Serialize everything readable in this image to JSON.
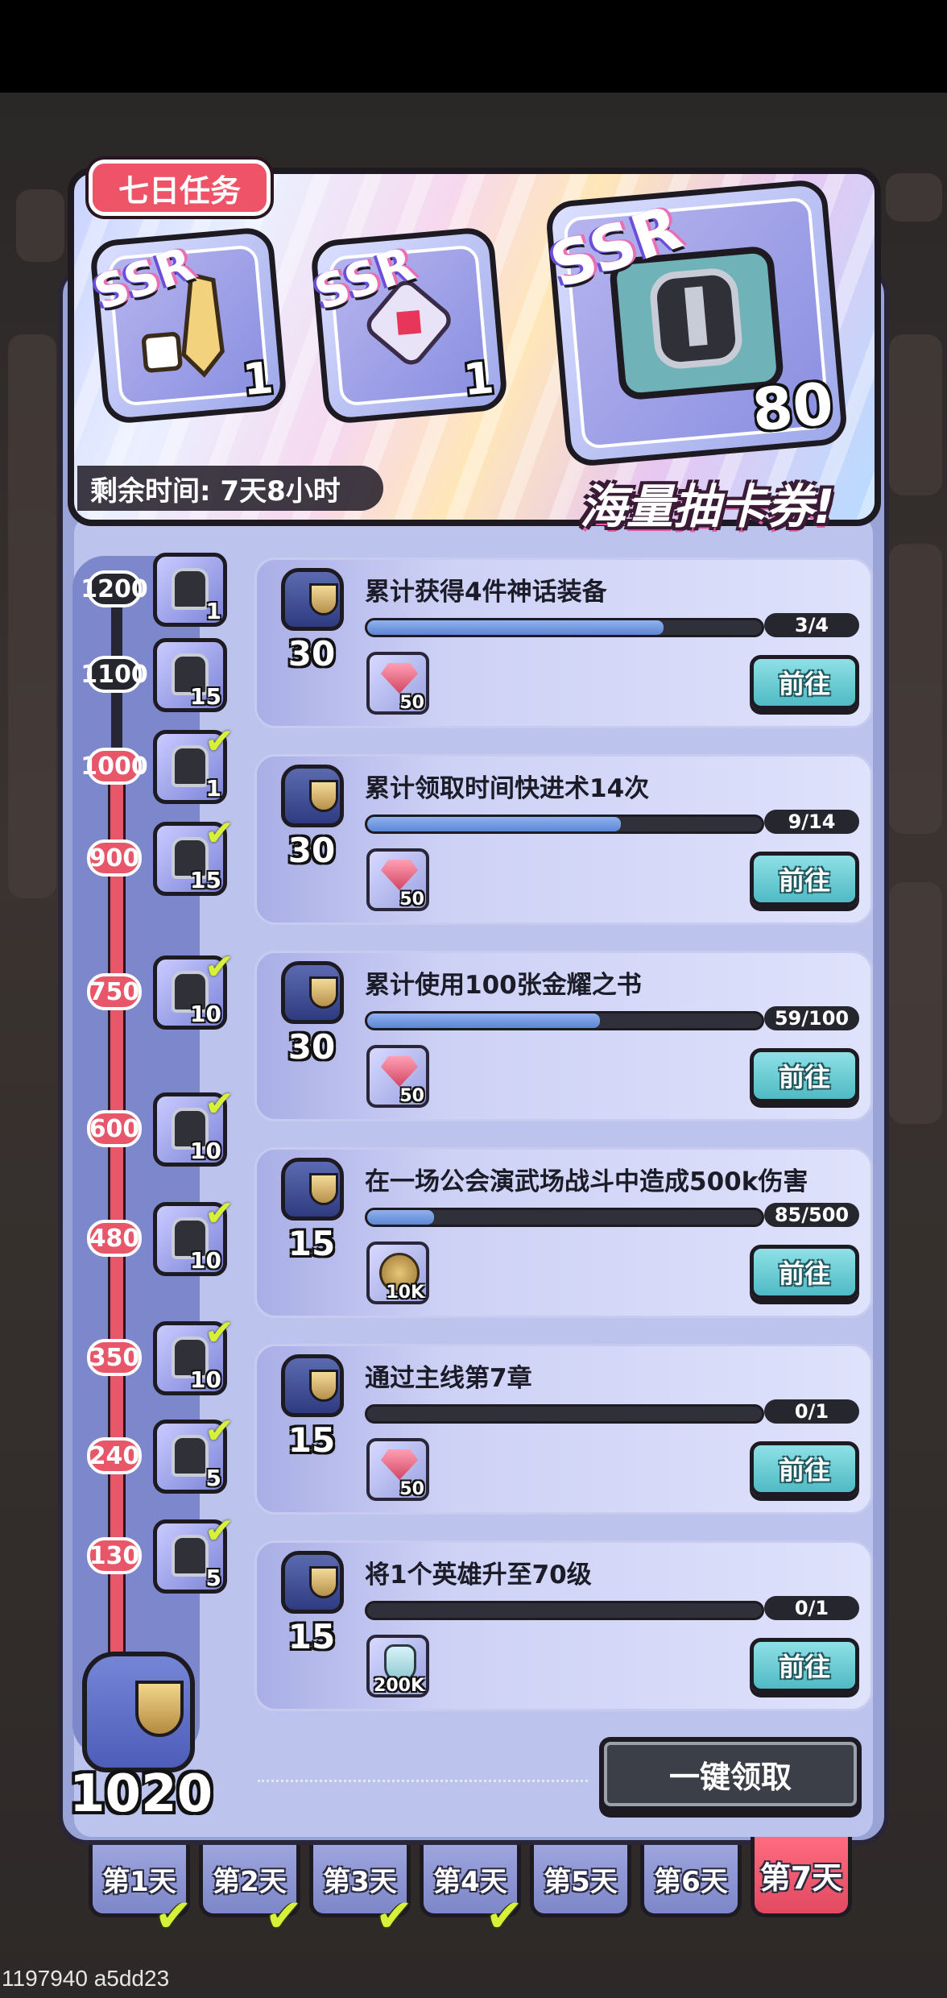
{
  "header": {
    "title": "七日任务",
    "timer": "剩余时间: 7天8小时",
    "slogan": "海量抽卡券!"
  },
  "banner_rewards": [
    {
      "tier": "SSR",
      "count": "1",
      "icon": "ssr-gold-relic-icon"
    },
    {
      "tier": "SSR",
      "count": "1",
      "icon": "ssr-red-gem-equipment-icon"
    },
    {
      "tier": "SSR",
      "count": "80",
      "icon": "ssr-summon-ticket-book-icon"
    }
  ],
  "milestones": [
    {
      "points": "1200",
      "count": "1",
      "claimed": false,
      "icon": "gem-equipment-icon"
    },
    {
      "points": "1100",
      "count": "15",
      "claimed": false,
      "icon": "helmet-book-icon"
    },
    {
      "points": "1000",
      "count": "1",
      "claimed": true,
      "icon": "ssr-relic-icon"
    },
    {
      "points": "900",
      "count": "15",
      "claimed": true,
      "icon": "helmet-book-icon"
    },
    {
      "points": "750",
      "count": "10",
      "claimed": true,
      "icon": "helmet-book-icon"
    },
    {
      "points": "600",
      "count": "10",
      "claimed": true,
      "icon": "helmet-book-icon"
    },
    {
      "points": "480",
      "count": "10",
      "claimed": true,
      "icon": "helmet-book-icon"
    },
    {
      "points": "350",
      "count": "10",
      "claimed": true,
      "icon": "helmet-book-icon"
    },
    {
      "points": "240",
      "count": "5",
      "claimed": true,
      "icon": "helmet-book-icon"
    },
    {
      "points": "130",
      "count": "5",
      "claimed": true,
      "icon": "helmet-book-icon"
    }
  ],
  "total_points": "1020",
  "tasks": [
    {
      "title": "累计获得4件神话装备",
      "points": "30",
      "progress_text": "3/4",
      "progress": 0.75,
      "reward_count": "50",
      "reward_icon": "gem"
    },
    {
      "title": "累计领取时间快进术14次",
      "points": "30",
      "progress_text": "9/14",
      "progress": 0.643,
      "reward_count": "50",
      "reward_icon": "gem"
    },
    {
      "title": "累计使用100张金耀之书",
      "points": "30",
      "progress_text": "59/100",
      "progress": 0.59,
      "reward_count": "50",
      "reward_icon": "gem"
    },
    {
      "title": "在一场公会演武场战斗中造成500k伤害",
      "points": "15",
      "progress_text": "85/500",
      "progress": 0.17,
      "reward_count": "10K",
      "reward_icon": "coin"
    },
    {
      "title": "通过主线第7章",
      "points": "15",
      "progress_text": "0/1",
      "progress": 0,
      "reward_count": "50",
      "reward_icon": "gem"
    },
    {
      "title": "将1个英雄升至70级",
      "points": "15",
      "progress_text": "0/1",
      "progress": 0,
      "reward_count": "200K",
      "reward_icon": "potion"
    }
  ],
  "go_label": "前往",
  "claim_all_label": "一键领取",
  "days": [
    {
      "label": "第1天",
      "completed": true,
      "active": false
    },
    {
      "label": "第2天",
      "completed": true,
      "active": false
    },
    {
      "label": "第3天",
      "completed": true,
      "active": false
    },
    {
      "label": "第4天",
      "completed": true,
      "active": false
    },
    {
      "label": "第5天",
      "completed": false,
      "active": false
    },
    {
      "label": "第6天",
      "completed": false,
      "active": false
    },
    {
      "label": "第7天",
      "completed": false,
      "active": true
    }
  ],
  "footer_id": "1197940 a5dd23",
  "colors": {
    "accent_red": "#e8566a",
    "go_button": "#4fbac4",
    "progress_fill": "#5d86d4",
    "check_green": "#d7f03a"
  }
}
